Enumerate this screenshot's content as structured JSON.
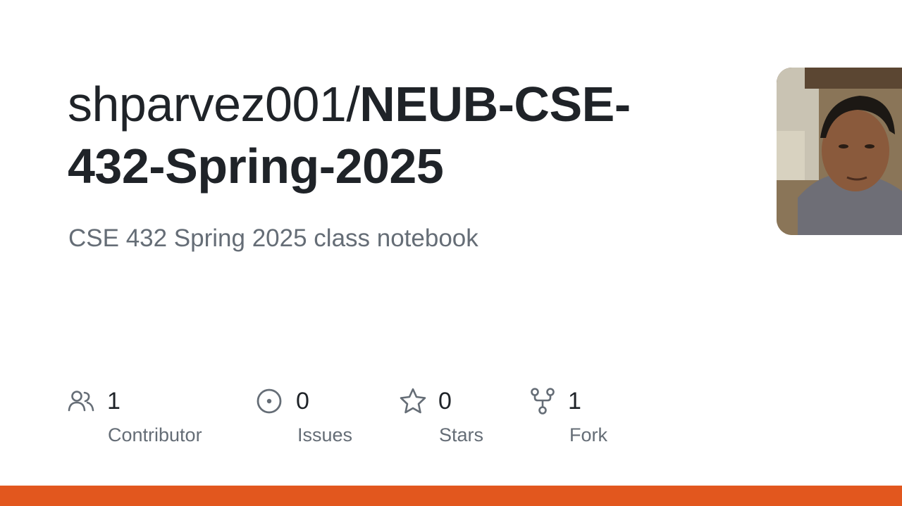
{
  "repo": {
    "owner": "shparvez001/",
    "name": "NEUB-CSE-432-Spring-2025",
    "description": "CSE 432 Spring 2025 class notebook"
  },
  "stats": [
    {
      "icon": "people-icon",
      "count": "1",
      "label": "Contributor"
    },
    {
      "icon": "issue-opened-icon",
      "count": "0",
      "label": "Issues"
    },
    {
      "icon": "star-icon",
      "count": "0",
      "label": "Stars"
    },
    {
      "icon": "repo-forked-icon",
      "count": "1",
      "label": "Fork"
    }
  ],
  "colors": {
    "accent_bar": "#e2571e",
    "title": "#1f2328",
    "muted": "#656d76"
  }
}
